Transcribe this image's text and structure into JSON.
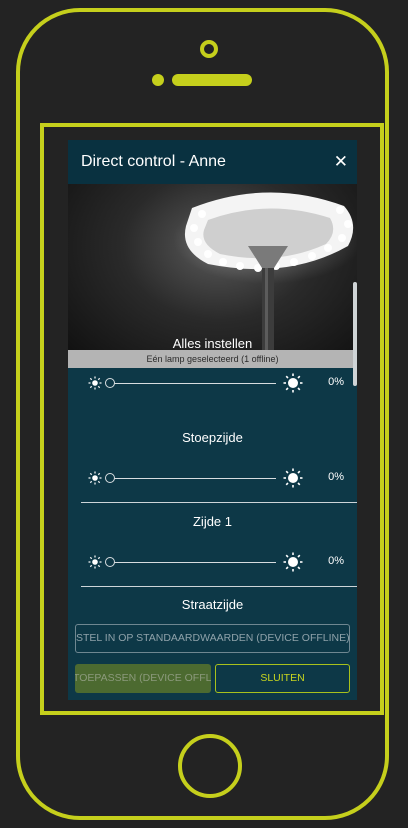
{
  "colors": {
    "accent": "#c5cf1c",
    "dialog_bg": "#0d3847",
    "header_bg": "#093140"
  },
  "dialog": {
    "title": "Direct control - Anne",
    "close_icon": "close-icon",
    "image_caption": "Eén lamp geselecteerd (1 offline)"
  },
  "sections": [
    {
      "title": "Alles instellen",
      "value": 0,
      "value_label": "0%"
    },
    {
      "title": "Stoepzijde",
      "value": 0,
      "value_label": "0%"
    },
    {
      "title": "Zijde 1",
      "value": 0,
      "value_label": "0%"
    },
    {
      "title": "Straatzijde"
    }
  ],
  "buttons": {
    "defaults": "STEL IN OP STANDAARDWAARDEN (DEVICE OFFLINE)",
    "apply": "TOEPASSEN (DEVICE OFFLINE)",
    "close": "SLUITEN"
  },
  "icons": {
    "brightness_low": "sun-low-icon",
    "brightness_high": "sun-high-icon"
  }
}
